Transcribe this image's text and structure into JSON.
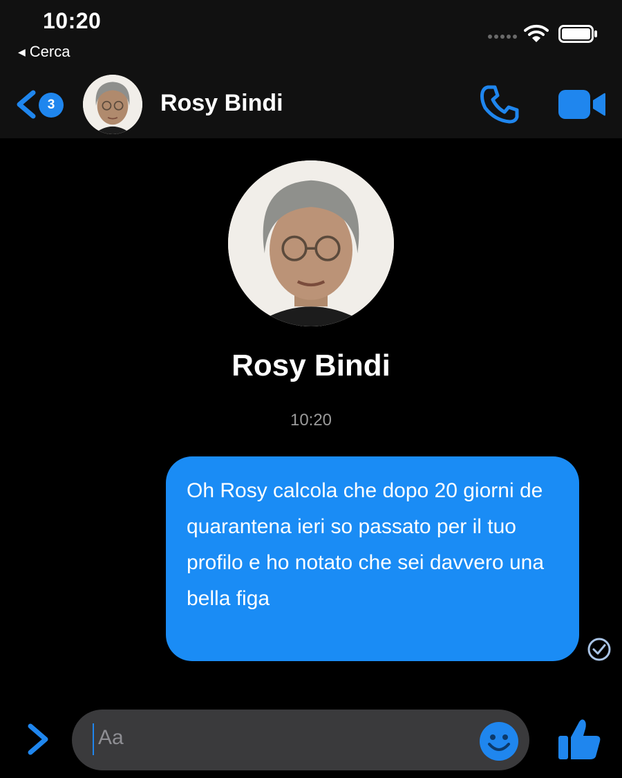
{
  "status_bar": {
    "time": "10:20",
    "back_label": "Cerca"
  },
  "header": {
    "unread_count": "3",
    "contact_name": "Rosy Bindi"
  },
  "conversation": {
    "profile_name": "Rosy Bindi",
    "timestamp": "10:20",
    "messages": [
      {
        "sender": "me",
        "text": "Oh Rosy calcola che dopo 20 giorni de quarantena ieri so passato per il tuo profilo e ho notato che sei davvero una bella figa",
        "status": "read"
      }
    ]
  },
  "composer": {
    "placeholder": "Aa"
  },
  "icons": {
    "back": "chevron-left-icon",
    "call": "phone-icon",
    "video": "video-camera-icon",
    "read": "check-circle-icon",
    "more": "chevron-right-icon",
    "emoji": "smiley-icon",
    "like": "thumbs-up-icon"
  },
  "colors": {
    "accent": "#1f86ee",
    "bubble": "#1a8cf5",
    "background": "#000000",
    "bar": "#111111",
    "composer": "#3a3a3c"
  }
}
